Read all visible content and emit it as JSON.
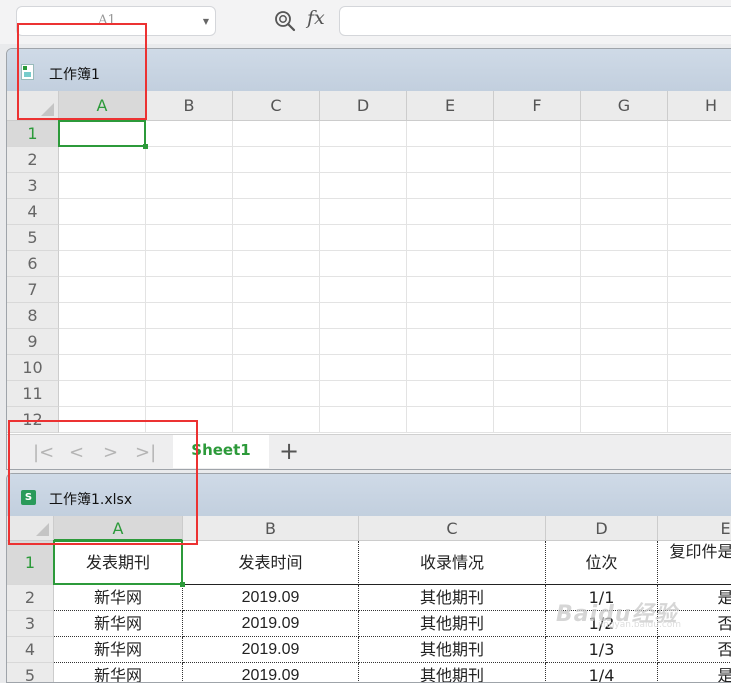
{
  "formula_bar": {
    "cell_ref": "A1",
    "formula_value": ""
  },
  "icons": {
    "zoom": "zoom-icon",
    "fx": "fx",
    "dropdown": "chevron-down-icon"
  },
  "window1": {
    "title": "工作簿1",
    "columns": [
      "A",
      "B",
      "C",
      "D",
      "E",
      "F",
      "G",
      "H"
    ],
    "rows": [
      "1",
      "2",
      "3",
      "4",
      "5",
      "6",
      "7",
      "8",
      "9",
      "10",
      "11",
      "12"
    ],
    "selected_cell": "A1",
    "sheet_tab": "Sheet1",
    "add_tab": "+"
  },
  "window2": {
    "title": "工作簿1.xlsx",
    "columns": [
      "A",
      "B",
      "C",
      "D",
      "E"
    ],
    "rows": [
      "1",
      "2",
      "3",
      "4",
      "5"
    ],
    "header_row": [
      "发表期刊",
      "发表时间",
      "收录情况",
      "位次",
      "复印件是否提交"
    ],
    "data_rows": [
      [
        "新华网",
        "2019.09",
        "其他期刊",
        "1/1",
        "是"
      ],
      [
        "新华网",
        "2019.09",
        "其他期刊",
        "1/2",
        "否"
      ],
      [
        "新华网",
        "2019.09",
        "其他期刊",
        "1/3",
        "否"
      ],
      [
        "新华网",
        "2019.09",
        "其他期刊",
        "1/4",
        "是"
      ]
    ]
  },
  "watermark": {
    "text": "Baidu经验",
    "sub": "jingyan.baidu.com"
  },
  "colors": {
    "accent_green": "#2c9a3a",
    "highlight_red": "#ec3232"
  }
}
